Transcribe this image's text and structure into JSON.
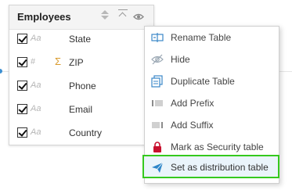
{
  "table": {
    "title": "Employees",
    "header_icons": [
      "sort-icon",
      "collapse-icon",
      "eye-icon"
    ],
    "fields": [
      {
        "name": "State",
        "type_icon": "Aa",
        "checked": true,
        "key_icon": ""
      },
      {
        "name": "ZIP",
        "type_icon": "#",
        "checked": true,
        "key_icon": "Σ"
      },
      {
        "name": "Phone",
        "type_icon": "Aa",
        "checked": true,
        "key_icon": ""
      },
      {
        "name": "Email",
        "type_icon": "Aa",
        "checked": true,
        "key_icon": ""
      },
      {
        "name": "Country",
        "type_icon": "Aa",
        "checked": true,
        "key_icon": ""
      }
    ]
  },
  "context_menu": {
    "items": [
      {
        "label": "Rename Table",
        "icon": "rename-icon"
      },
      {
        "label": "Hide",
        "icon": "hide-icon"
      },
      {
        "label": "Duplicate Table",
        "icon": "duplicate-icon"
      },
      {
        "label": "Add Prefix",
        "icon": "prefix-icon"
      },
      {
        "label": "Add Suffix",
        "icon": "suffix-icon"
      },
      {
        "label": "Mark as Security table",
        "icon": "lock-icon"
      },
      {
        "label": "Set as distribution table",
        "icon": "send-icon",
        "highlighted": true
      }
    ]
  },
  "colors": {
    "highlight_border": "#35c91e",
    "accent_blue": "#2e86c9",
    "lock_red": "#c8102e",
    "sigma_orange": "#d99a2b"
  }
}
